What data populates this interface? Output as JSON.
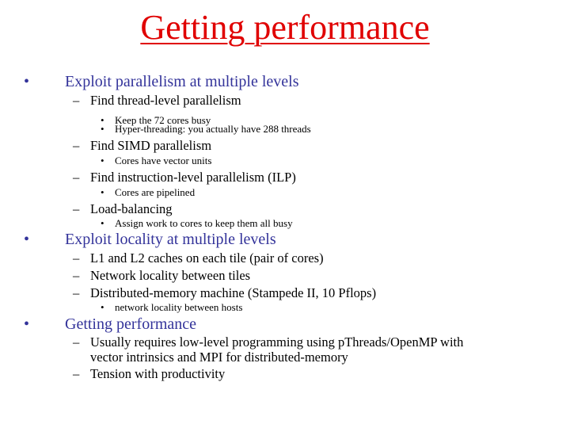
{
  "slide": {
    "title": "Getting performance",
    "colors": {
      "title": "#e00000",
      "level1": "#33339a",
      "body": "#000000"
    },
    "markers": {
      "level1": "•",
      "level2": "–",
      "level3": "•"
    },
    "items": [
      {
        "text": "Exploit parallelism at multiple levels"
      },
      {
        "text": "Find thread-level parallelism"
      },
      {
        "text": "Keep the 72 cores busy"
      },
      {
        "text": "Hyper-threading: you actually have 288 threads"
      },
      {
        "text": "Find SIMD parallelism"
      },
      {
        "text": "Cores have vector units"
      },
      {
        "text": "Find instruction-level parallelism (ILP)"
      },
      {
        "text": "Cores are pipelined"
      },
      {
        "text": "Load-balancing"
      },
      {
        "text": "Assign work to cores to keep them all busy"
      },
      {
        "text": "Exploit locality at multiple levels"
      },
      {
        "text": "L1 and L2 caches on each tile (pair of cores)"
      },
      {
        "text": "Network locality between tiles"
      },
      {
        "text": "Distributed-memory machine (Stampede II, 10 Pflops)"
      },
      {
        "text": "network locality between hosts"
      },
      {
        "text": "Getting performance"
      },
      {
        "text": "Usually requires low-level programming using pThreads/OpenMP with"
      },
      {
        "text": "vector intrinsics and MPI for distributed-memory"
      },
      {
        "text": "Tension with productivity"
      }
    ]
  }
}
